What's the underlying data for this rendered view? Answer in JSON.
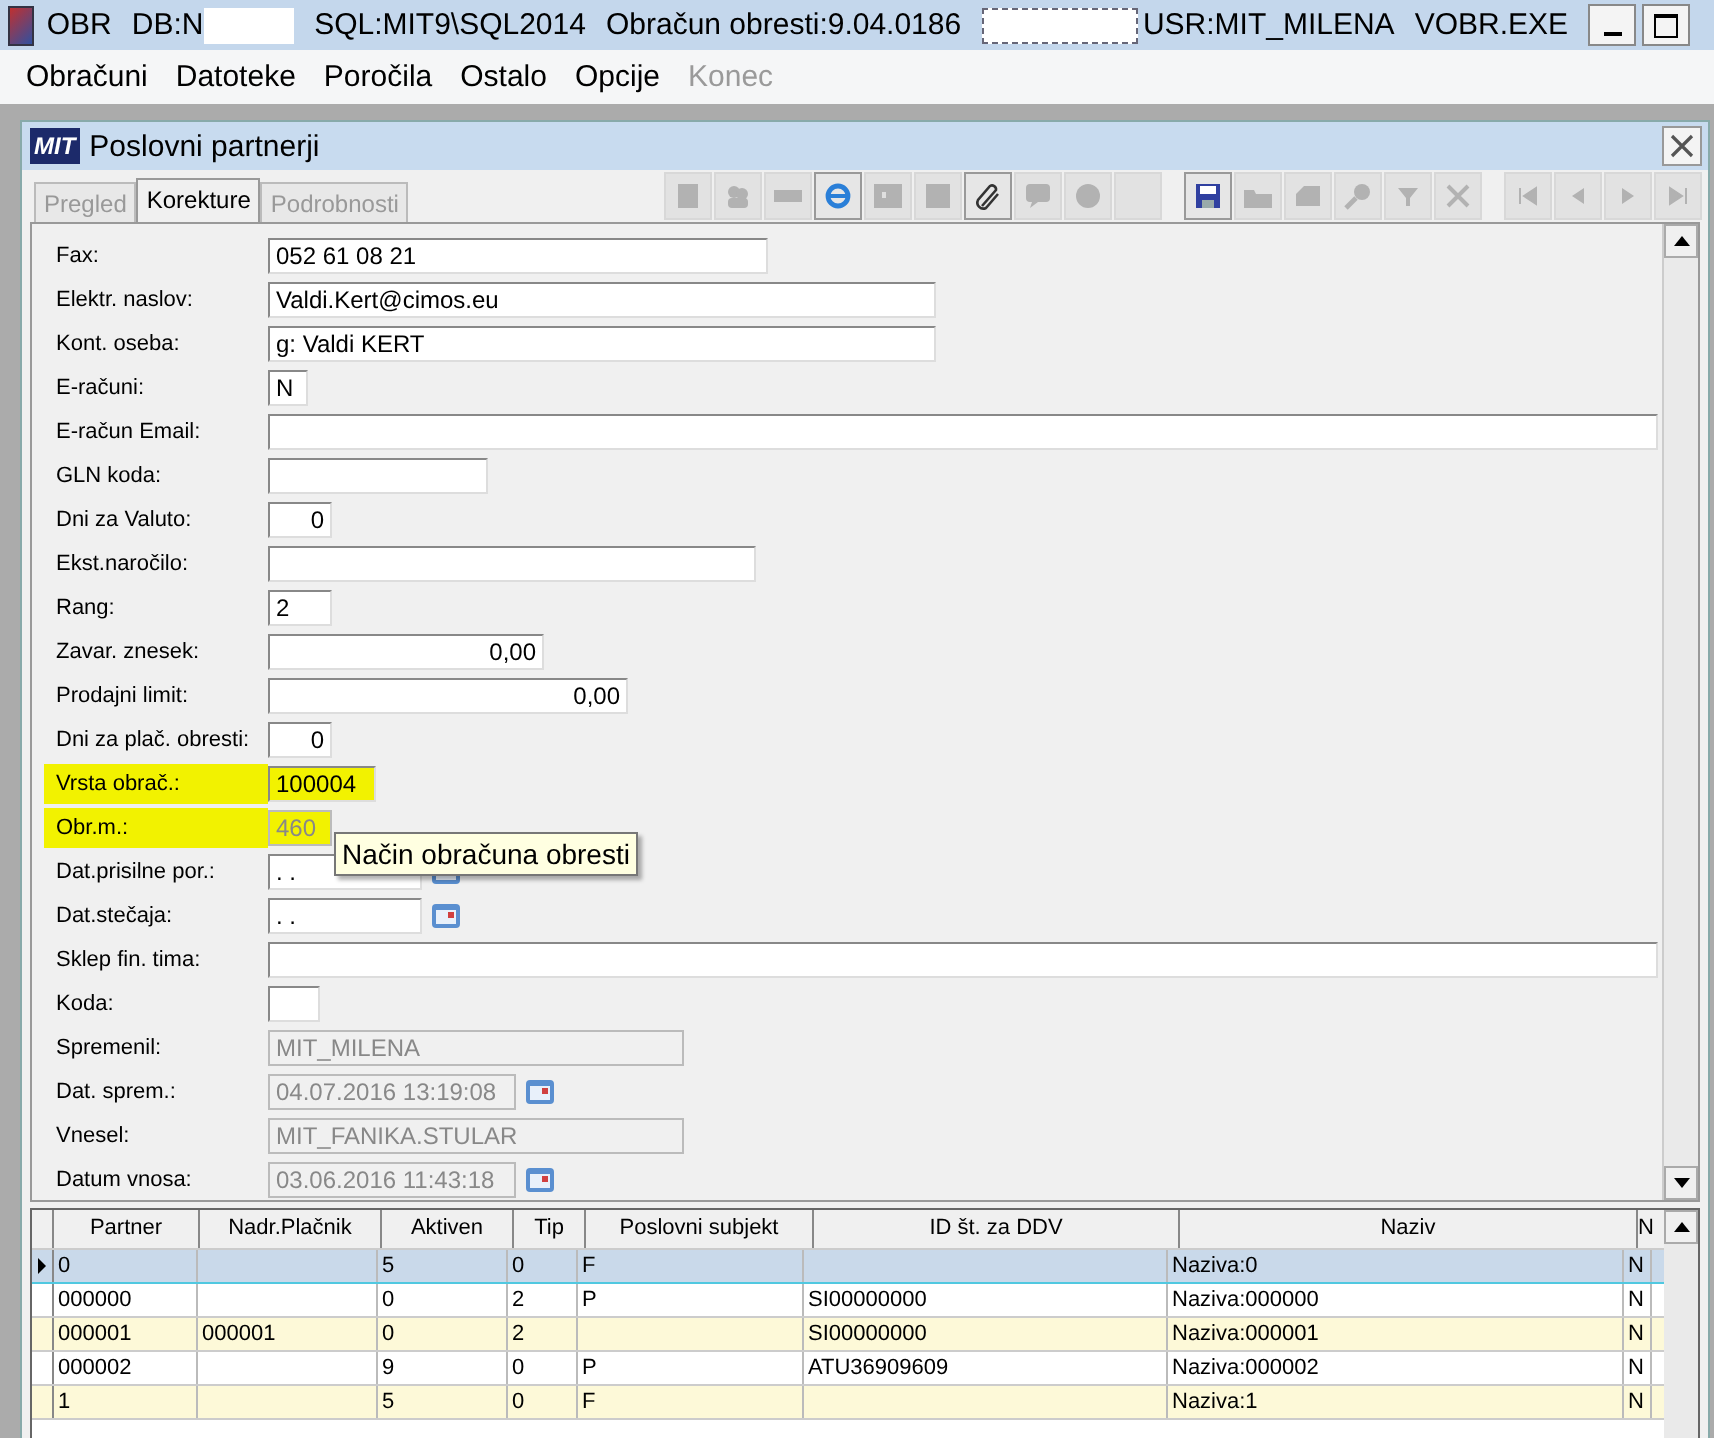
{
  "window": {
    "title": "OBR",
    "db": "DB:N",
    "sql": "SQL:MIT9\\SQL2014",
    "app": "Obračun obresti:9.04.0186",
    "user": "USR:MIT_MILENA",
    "exe": "VOBR.EXE"
  },
  "menu": [
    {
      "label": "Obračuni",
      "disabled": false
    },
    {
      "label": "Datoteke",
      "disabled": false
    },
    {
      "label": "Poročila",
      "disabled": false
    },
    {
      "label": "Ostalo",
      "disabled": false
    },
    {
      "label": "Opcije",
      "disabled": false
    },
    {
      "label": "Konec",
      "disabled": true
    }
  ],
  "child_window": {
    "logo": "MIT",
    "title": "Poslovni partnerji"
  },
  "tabs": [
    {
      "label": "Pregled",
      "selected": false,
      "disabled": true
    },
    {
      "label": "Korekture",
      "selected": true,
      "disabled": false
    },
    {
      "label": "Podrobnosti",
      "selected": false,
      "disabled": true
    }
  ],
  "toolbar": [
    {
      "kind": "doc",
      "disabled": true
    },
    {
      "kind": "people",
      "disabled": true
    },
    {
      "kind": "bar",
      "disabled": true
    },
    {
      "kind": "browser",
      "disabled": false
    },
    {
      "kind": "panel",
      "disabled": true
    },
    {
      "kind": "square",
      "disabled": true
    },
    {
      "kind": "clip",
      "disabled": false
    },
    {
      "kind": "chat",
      "disabled": true
    },
    {
      "kind": "circle",
      "disabled": true
    },
    {
      "kind": "blank",
      "disabled": true
    },
    {
      "kind": "save",
      "disabled": false
    },
    {
      "kind": "folder",
      "disabled": true
    },
    {
      "kind": "stack",
      "disabled": true
    },
    {
      "kind": "search",
      "disabled": true
    },
    {
      "kind": "filter",
      "disabled": true
    },
    {
      "kind": "close",
      "disabled": true
    },
    {
      "kind": "first",
      "disabled": true
    },
    {
      "kind": "prev",
      "disabled": true
    },
    {
      "kind": "next",
      "disabled": true
    },
    {
      "kind": "last",
      "disabled": true
    }
  ],
  "form": [
    {
      "label": "Fax:",
      "value": "052 61 08 21",
      "kind": "text",
      "disabled": false,
      "highlighted": false
    },
    {
      "label": "Elektr. naslov:",
      "value": "Valdi.Kert@cimos.eu",
      "kind": "text",
      "disabled": false,
      "highlighted": false
    },
    {
      "label": "Kont. oseba:",
      "value": "g: Valdi KERT",
      "kind": "text",
      "disabled": false,
      "highlighted": false
    },
    {
      "label": "E-računi:",
      "value": "N",
      "kind": "text",
      "disabled": false,
      "highlighted": false
    },
    {
      "label": "E-račun Email:",
      "kind": "text",
      "disabled": false,
      "highlighted": false
    },
    {
      "label": "GLN koda:",
      "kind": "text",
      "disabled": false,
      "highlighted": false
    },
    {
      "label": "Dni za Valuto:",
      "value": "0",
      "kind": "number",
      "disabled": false,
      "highlighted": false
    },
    {
      "label": "Ekst.naročilo:",
      "kind": "text",
      "disabled": false,
      "highlighted": false
    },
    {
      "label": "Rang:",
      "value": "2",
      "kind": "text",
      "disabled": false,
      "highlighted": false
    },
    {
      "label": "Zavar. znesek:",
      "value": "0,00",
      "kind": "number",
      "disabled": false,
      "highlighted": false
    },
    {
      "label": "Prodajni limit:",
      "value": "0,00",
      "kind": "number",
      "disabled": false,
      "highlighted": false
    },
    {
      "label": "Dni za plač. obresti:",
      "value": "0",
      "kind": "number",
      "disabled": false,
      "highlighted": false
    },
    {
      "label": "Vrsta obrač.:",
      "value": "100004",
      "kind": "text",
      "disabled": false,
      "highlighted": true
    },
    {
      "label": "Obr.m.:",
      "value": "460",
      "kind": "text",
      "disabled": true,
      "highlighted": true
    },
    {
      "label": "Dat.prisilne por.:",
      "value": ". .",
      "kind": "date",
      "disabled": false,
      "highlighted": false
    },
    {
      "label": "Dat.stečaja:",
      "value": ". .",
      "kind": "date",
      "disabled": false,
      "highlighted": false
    },
    {
      "label": "Sklep fin. tima:",
      "kind": "text",
      "disabled": false,
      "highlighted": false
    },
    {
      "label": "Koda:",
      "kind": "text",
      "disabled": false,
      "highlighted": false
    },
    {
      "label": "Spremenil:",
      "value": "MIT_MILENA",
      "kind": "text",
      "disabled": true,
      "highlighted": false
    },
    {
      "label": "Dat. sprem.:",
      "value": "04.07.2016 13:19:08",
      "kind": "date",
      "disabled": true,
      "highlighted": false
    },
    {
      "label": "Vnesel:",
      "value": "MIT_FANIKA.STULAR",
      "kind": "text",
      "disabled": true,
      "highlighted": false
    },
    {
      "label": "Datum vnosa:",
      "value": "03.06.2016 11:43:18",
      "kind": "date",
      "disabled": true,
      "highlighted": false
    }
  ],
  "tooltip": "Način obračuna obresti",
  "table": {
    "columns": [
      "Partner",
      "Nadr.Plačnik",
      "Aktiven",
      "Tip",
      "Poslovni subjekt",
      "ID št. za DDV",
      "Naziv",
      "N"
    ],
    "rows": [
      {
        "cells": [
          "0",
          "",
          "5",
          "0",
          "F",
          "",
          "Naziva:0",
          "N"
        ],
        "selected": true
      },
      {
        "cells": [
          "000000",
          "",
          "0",
          "2",
          "P",
          "SI00000000",
          "Naziva:000000",
          "N"
        ],
        "selected": false
      },
      {
        "cells": [
          "000001",
          "000001",
          "0",
          "2",
          "",
          "SI00000000",
          "Naziva:000001",
          "N"
        ],
        "selected": false
      },
      {
        "cells": [
          "000002",
          "",
          "9",
          "0",
          "P",
          "ATU36909609",
          "Naziva:000002",
          "N"
        ],
        "selected": false
      },
      {
        "cells": [
          "1",
          "",
          "5",
          "0",
          "F",
          "",
          "Naziva:1",
          "N"
        ],
        "selected": false
      }
    ]
  }
}
